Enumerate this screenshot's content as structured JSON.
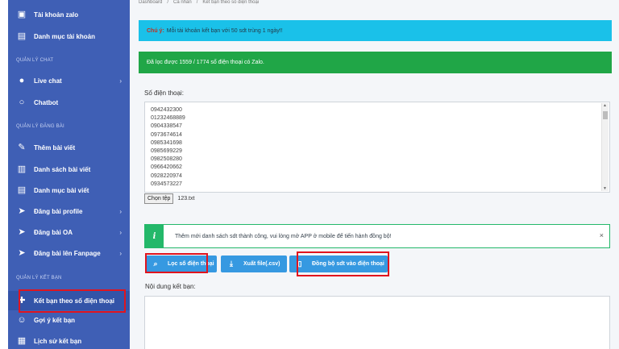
{
  "sidebar": {
    "items_top": [
      {
        "label": "Tài khoản zalo",
        "icon": "id-card-icon"
      },
      {
        "label": "Danh mục tài khoản",
        "icon": "list-icon"
      }
    ],
    "section_chat": "QUẢN LÝ CHAT",
    "chat_items": [
      {
        "label": "Live chat",
        "icon": "chat-bubbles-icon",
        "has_submenu": true
      },
      {
        "label": "Chatbot",
        "icon": "chat-bubble-icon",
        "has_submenu": false
      }
    ],
    "section_posts": "QUẢN LÝ ĐĂNG BÀI",
    "post_items": [
      {
        "label": "Thêm bài viết",
        "icon": "edit-icon",
        "has_submenu": false
      },
      {
        "label": "Danh sách bài viết",
        "icon": "book-icon",
        "has_submenu": false
      },
      {
        "label": "Danh mục bài viết",
        "icon": "list-icon",
        "has_submenu": false
      },
      {
        "label": "Đăng bài profile",
        "icon": "send-icon",
        "has_submenu": true
      },
      {
        "label": "Đăng bài OA",
        "icon": "send-icon",
        "has_submenu": true
      },
      {
        "label": "Đăng bài lên Fanpage",
        "icon": "send-icon",
        "has_submenu": true
      }
    ],
    "section_friends": "QUẢN LÝ KẾT BẠN",
    "friend_items": [
      {
        "label": "Kết bạn theo số điện thoại",
        "icon": "add-user-icon",
        "active": true
      },
      {
        "label": "Gợi ý kết bạn",
        "icon": "users-icon",
        "active": false
      },
      {
        "label": "Lịch sử kết bạn",
        "icon": "history-icon",
        "active": false
      }
    ]
  },
  "breadcrumb": [
    "Dashboard",
    "Cá nhân",
    "Kết bạn theo số điện thoại"
  ],
  "alerts": {
    "note_label": "Chú ý:",
    "note_text": "Mỗi tài khoản kết bạn với 50 sdt trùng 1 ngày!!",
    "success_text": "Đã lọc được 1559 / 1774 số điện thoại có Zalo."
  },
  "phones": {
    "label": "Số điện thoại:",
    "numbers": [
      "0942432300",
      "01232468889",
      "0904338547",
      "0973674614",
      "0985341698",
      "0985699229",
      "0982508280",
      "0966420662",
      "0928220974",
      "0934573227"
    ]
  },
  "file": {
    "button_label": "Chọn tệp",
    "file_name": "123.txt"
  },
  "info": {
    "icon_glyph": "i",
    "text": "Thêm mới danh sách sdt thành công, vui lòng mở APP ở mobile để tiến hành đồng bộ!",
    "close_glyph": "×"
  },
  "buttons": {
    "filter_label": "Lọc số điện thoại",
    "export_label": "Xuất file(.csv)",
    "sync_label": "Đồng bộ sdt vào điện thoại"
  },
  "content": {
    "label": "Nội dung kết bạn:"
  },
  "colors": {
    "sidebar_bg": "#3f5fb5",
    "note_bg": "#1ac1e9",
    "success_bg": "#20a647",
    "button_bg": "#3699e1",
    "highlight": "#e0141e"
  }
}
